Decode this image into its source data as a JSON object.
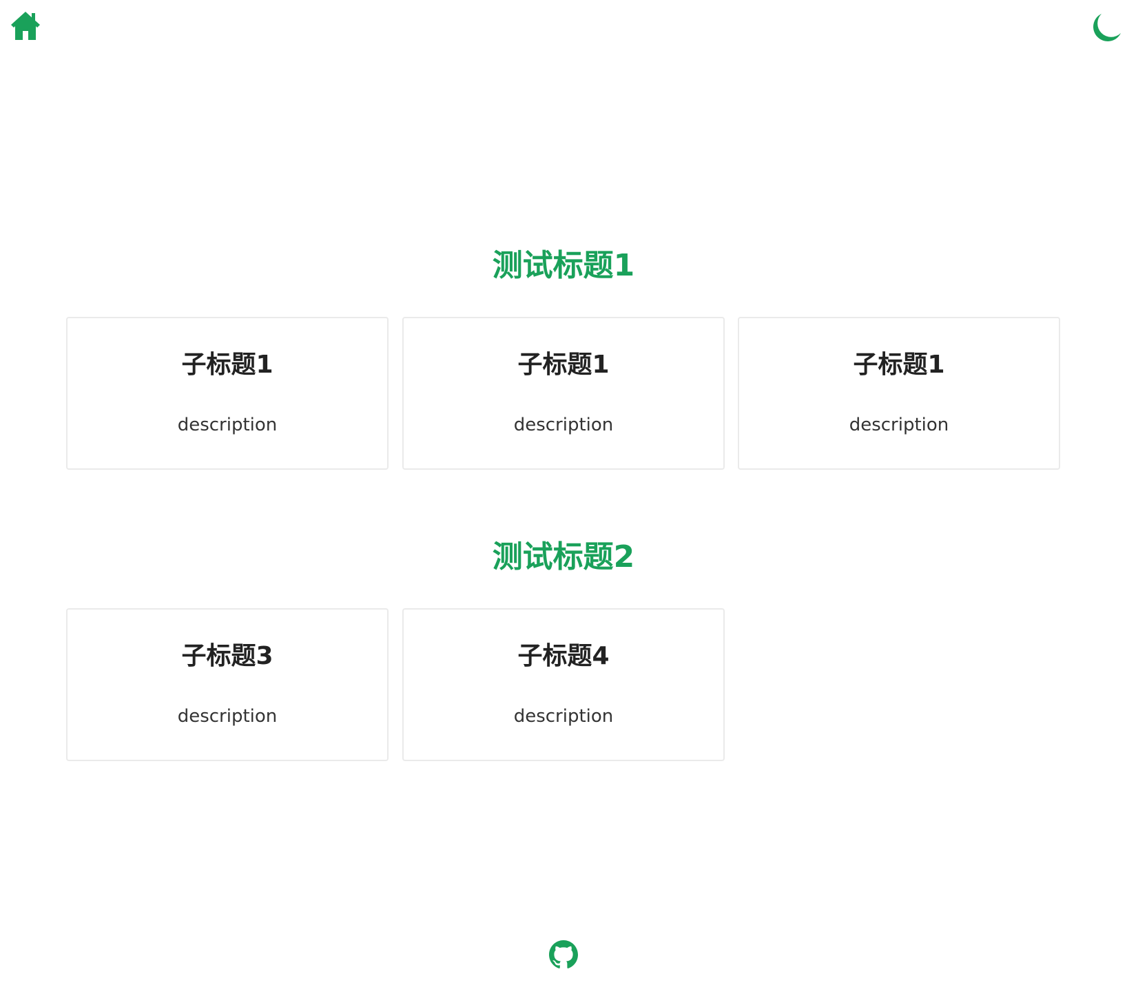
{
  "colors": {
    "accent": "#1aa15a",
    "card_border": "#eaeaea",
    "card_title": "#222222",
    "card_desc": "#333333",
    "background": "#ffffff"
  },
  "header": {
    "home_icon": "home-icon",
    "theme_icon": "moon-icon"
  },
  "sections": [
    {
      "title": "测试标题1",
      "cards": [
        {
          "title": "子标题1",
          "description": "description"
        },
        {
          "title": "子标题1",
          "description": "description"
        },
        {
          "title": "子标题1",
          "description": "description"
        }
      ]
    },
    {
      "title": "测试标题2",
      "cards": [
        {
          "title": "子标题3",
          "description": "description"
        },
        {
          "title": "子标题4",
          "description": "description"
        }
      ]
    }
  ],
  "footer": {
    "github_icon": "github-icon"
  }
}
